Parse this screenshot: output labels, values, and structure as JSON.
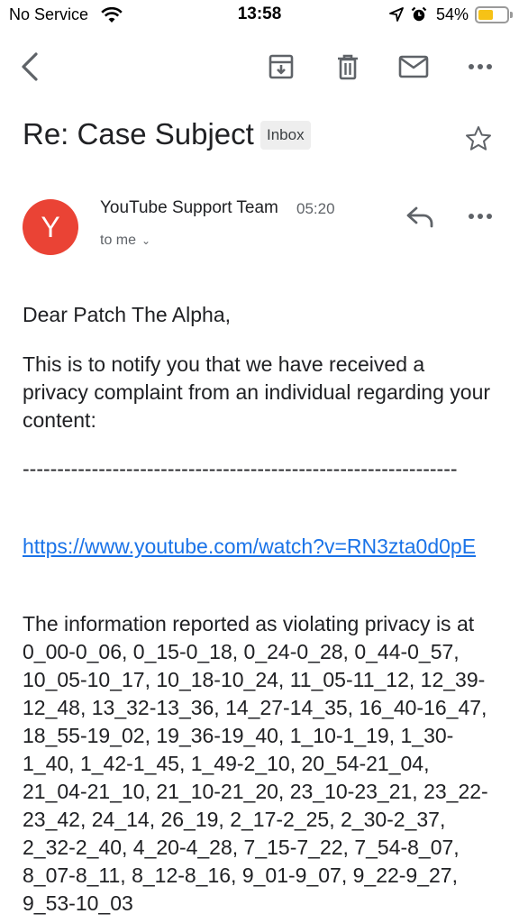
{
  "status_bar": {
    "carrier": "No Service",
    "time": "13:58",
    "battery": "54%",
    "battery_level": 0.54,
    "icons": [
      "wifi-icon",
      "location-arrow-icon",
      "alarm-clock-icon",
      "battery-icon"
    ]
  },
  "toolbar": {
    "icons": [
      "back-arrow-icon",
      "archive-icon",
      "trash-icon",
      "mail-icon",
      "more-horizontal-icon"
    ]
  },
  "email": {
    "subject": "Re: Case Subject",
    "label": "Inbox",
    "sender_initial": "Y",
    "sender_name": "YouTube Support Team",
    "time": "05:20",
    "recipient": "to me",
    "avatar_color": "#ea4335",
    "link_color": "#1a73e8",
    "body": {
      "greeting": "Dear Patch The Alpha,",
      "paragraph_1": "This is to notify you that we have received a privacy complaint from an individual regarding your content:",
      "separator": "---------------------------------------------------------------",
      "link": "https://www.youtube.com/watch?v=RN3zta0d0pE",
      "paragraph_2": "The information reported as violating privacy is at 0_00-0_06, 0_15-0_18, 0_24-0_28, 0_44-0_57, 10_05-10_17, 10_18-10_24, 11_05-11_12, 12_39-12_48, 13_32-13_36, 14_27-14_35, 16_40-16_47, 18_55-19_02, 19_36-19_40, 1_10-1_19, 1_30-1_40, 1_42-1_45, 1_49-2_10, 20_54-21_04, 21_04-21_10, 21_10-21_20, 23_10-23_21, 23_22-23_42, 24_14, 26_19, 2_17-2_25, 2_30-2_37, 2_32-2_40, 4_20-4_28, 7_15-7_22, 7_54-8_07, 8_07-8_11, 8_12-8_16, 9_01-9_07, 9_22-9_27, 9_53-10_03"
    }
  }
}
